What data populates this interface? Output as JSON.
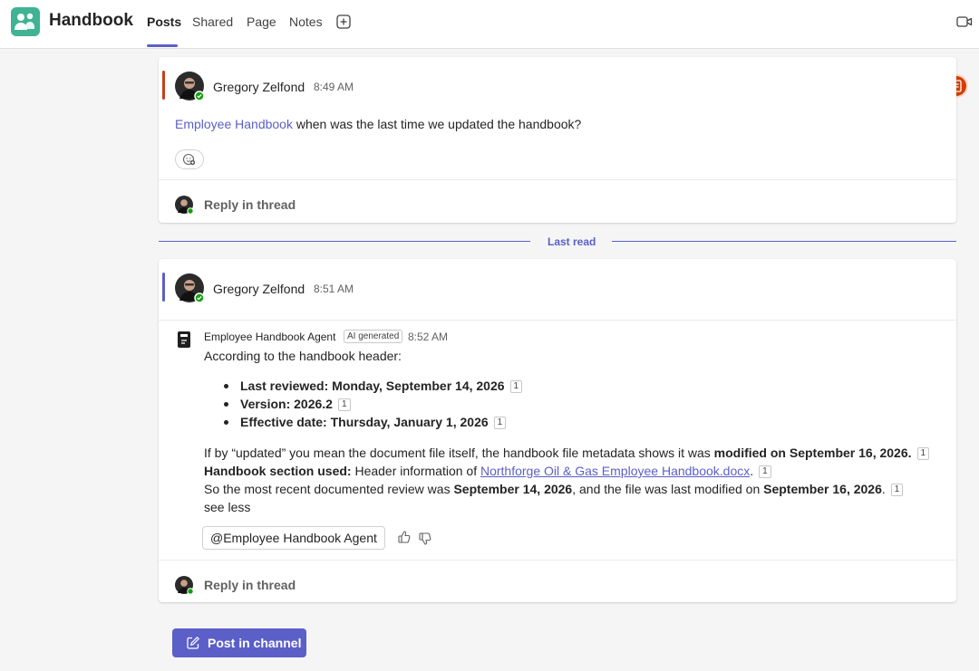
{
  "header": {
    "app_title": "Handbook",
    "tabs": [
      {
        "label": "Posts",
        "active": true
      },
      {
        "label": "Shared",
        "active": false
      },
      {
        "label": "Page",
        "active": false
      },
      {
        "label": "Notes",
        "active": false
      }
    ]
  },
  "colors": {
    "accent": "#5b5fc7",
    "thread1_accent": "#c43e1c",
    "thread2_accent": "#5b5fc7",
    "app_icon": "#3fb394",
    "presence": "#13a10e"
  },
  "thread1": {
    "author": "Gregory Zelfond",
    "time": "8:49 AM",
    "mention": "Employee Handbook",
    "message": " when was the last time we updated the handbook?",
    "reply_label": "Reply in thread"
  },
  "last_read_label": "Last read",
  "thread2": {
    "author": "Gregory Zelfond",
    "time": "8:51 AM",
    "reply_label": "Reply in thread",
    "agent": {
      "name": "Employee Handbook Agent",
      "badge": "AI generated",
      "time": "8:52 AM",
      "intro": "According to the handbook header:",
      "bullets": [
        {
          "label": "Last reviewed: Monday, September 14, 2026",
          "cite": "1"
        },
        {
          "label": "Version: 2026.2",
          "cite": "1"
        },
        {
          "label": "Effective date: Thursday, January 1, 2026",
          "cite": "1"
        }
      ],
      "para1_pre": "If by “updated” you mean the document file itself, the handbook file metadata shows it was ",
      "para1_bold": "modified on September 16, 2026.",
      "para1_cite": "1",
      "para2_label": "Handbook section used:",
      "para2_pre": " Header information of ",
      "para2_link": "Northforge Oil & Gas Employee Handbook.docx",
      "para2_post": ".",
      "para2_cite": "1",
      "para3_pre": "So the most recent documented review was ",
      "para3_bold1": "September 14, 2026",
      "para3_mid": ", and the file was last modified on ",
      "para3_bold2": "September 16, 2026",
      "para3_post": ".",
      "para3_cite": "1",
      "see_less": "see less",
      "mention_button": "@Employee Handbook Agent"
    }
  },
  "post_button": "Post in channel",
  "icons": [
    "teams-app-icon",
    "add-tab-icon",
    "video-icon",
    "emoji-add-icon",
    "thumbs-up-icon",
    "thumbs-down-icon",
    "compose-icon",
    "agent-book-icon",
    "notes-badge-icon"
  ]
}
